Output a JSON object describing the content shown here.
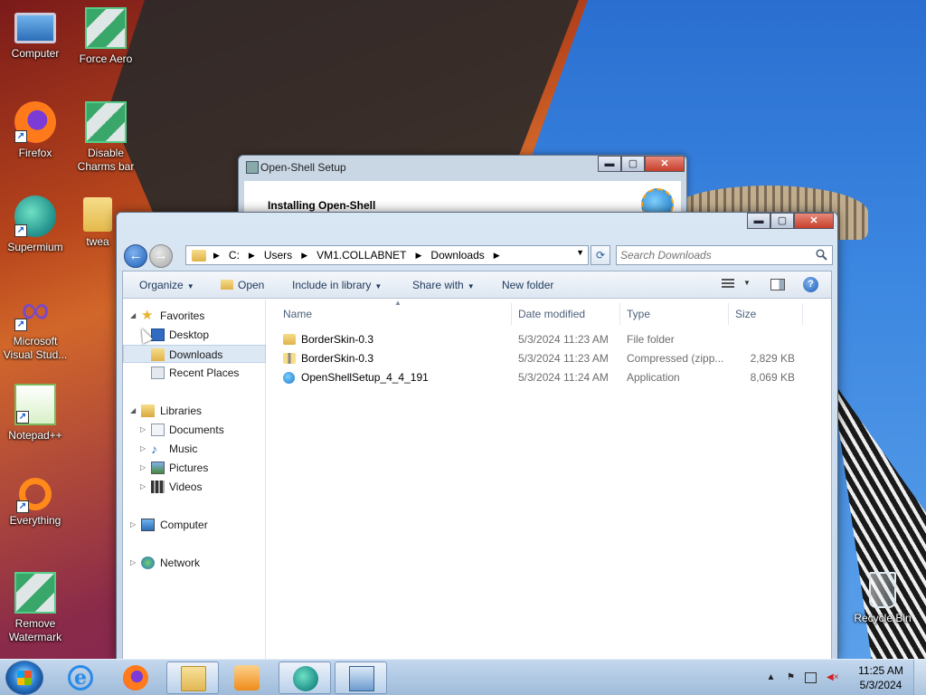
{
  "desktop": {
    "icons": [
      {
        "label": "Computer",
        "icon": "computer-icon"
      },
      {
        "label": "Force Aero",
        "icon": "registry-icon"
      },
      {
        "label": "Firefox",
        "icon": "firefox-icon"
      },
      {
        "label": "Disable Charms bar",
        "icon": "registry-icon"
      },
      {
        "label": "Supermium",
        "icon": "supermium-icon"
      },
      {
        "label": "twea",
        "icon": "folder-icon"
      },
      {
        "label": "Microsoft Visual Stud...",
        "icon": "visual-studio-icon"
      },
      {
        "label": "Notepad++",
        "icon": "notepadpp-icon"
      },
      {
        "label": "Everything",
        "icon": "everything-icon"
      },
      {
        "label": "Remove Watermark",
        "icon": "registry-icon"
      },
      {
        "label": "Recycle Bin",
        "icon": "recycle-bin-icon"
      }
    ]
  },
  "setup_window": {
    "title": "Open-Shell Setup",
    "heading": "Installing Open-Shell",
    "min": "▬",
    "max": "▢",
    "close": "✕"
  },
  "explorer": {
    "min": "▬",
    "max": "▢",
    "close": "✕",
    "nav": {
      "back": "←",
      "forward": "→",
      "refresh": "⟳"
    },
    "breadcrumb": [
      "C:",
      "Users",
      "VM1.COLLABNET",
      "Downloads"
    ],
    "search_placeholder": "Search Downloads",
    "commands": {
      "organize": "Organize",
      "open": "Open",
      "include_in_library": "Include in library",
      "share_with": "Share with",
      "new_folder": "New folder",
      "help": "?"
    },
    "navpane": {
      "favorites": "Favorites",
      "favorites_items": [
        "Desktop",
        "Downloads",
        "Recent Places"
      ],
      "selected": "Downloads",
      "libraries": "Libraries",
      "libraries_items": [
        "Documents",
        "Music",
        "Pictures",
        "Videos"
      ],
      "computer": "Computer",
      "network": "Network"
    },
    "columns": [
      "Name",
      "Date modified",
      "Type",
      "Size"
    ],
    "files": [
      {
        "name": "BorderSkin-0.3",
        "date": "5/3/2024 11:23 AM",
        "type": "File folder",
        "size": "",
        "icon": "folder-icon"
      },
      {
        "name": "BorderSkin-0.3",
        "date": "5/3/2024 11:23 AM",
        "type": "Compressed (zipp...",
        "size": "2,829 KB",
        "icon": "zip-folder-icon"
      },
      {
        "name": "OpenShellSetup_4_4_191",
        "date": "5/3/2024 11:24 AM",
        "type": "Application",
        "size": "8,069 KB",
        "icon": "openshell-icon"
      }
    ]
  },
  "taskbar": {
    "pinned": [
      "start-button",
      "internet-explorer-icon",
      "firefox-icon",
      "explorer-icon",
      "media-player-icon",
      "supermium-icon",
      "setup-icon"
    ],
    "tray": {
      "time": "11:25 AM",
      "date": "5/3/2024"
    }
  }
}
